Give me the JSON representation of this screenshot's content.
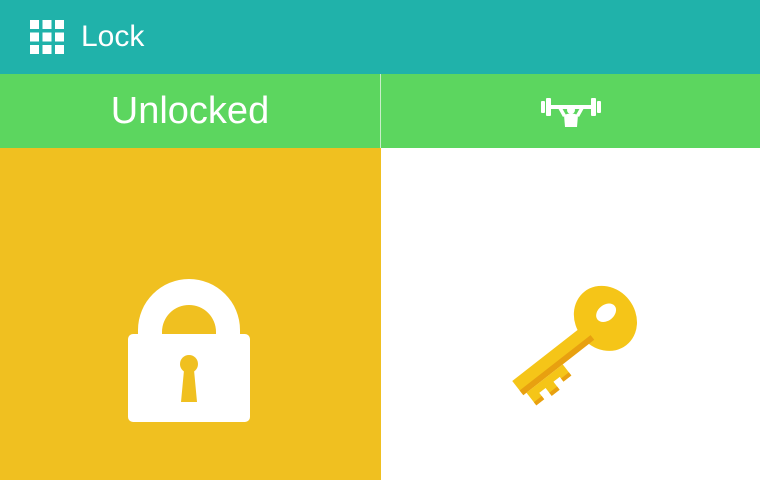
{
  "header": {
    "title": "Lock",
    "menu_icon": "grid-menu-icon",
    "background": "#20b2aa"
  },
  "status_bar": {
    "status_label": "Unlocked",
    "activity_icon": "weightlifter-icon",
    "background": "#5cd65f"
  },
  "panels": {
    "lock": {
      "icon": "padlock-icon",
      "background": "#f0c020"
    },
    "key": {
      "icon": "key-icon",
      "background": "#ffffff",
      "icon_color": "#f5c518"
    }
  }
}
